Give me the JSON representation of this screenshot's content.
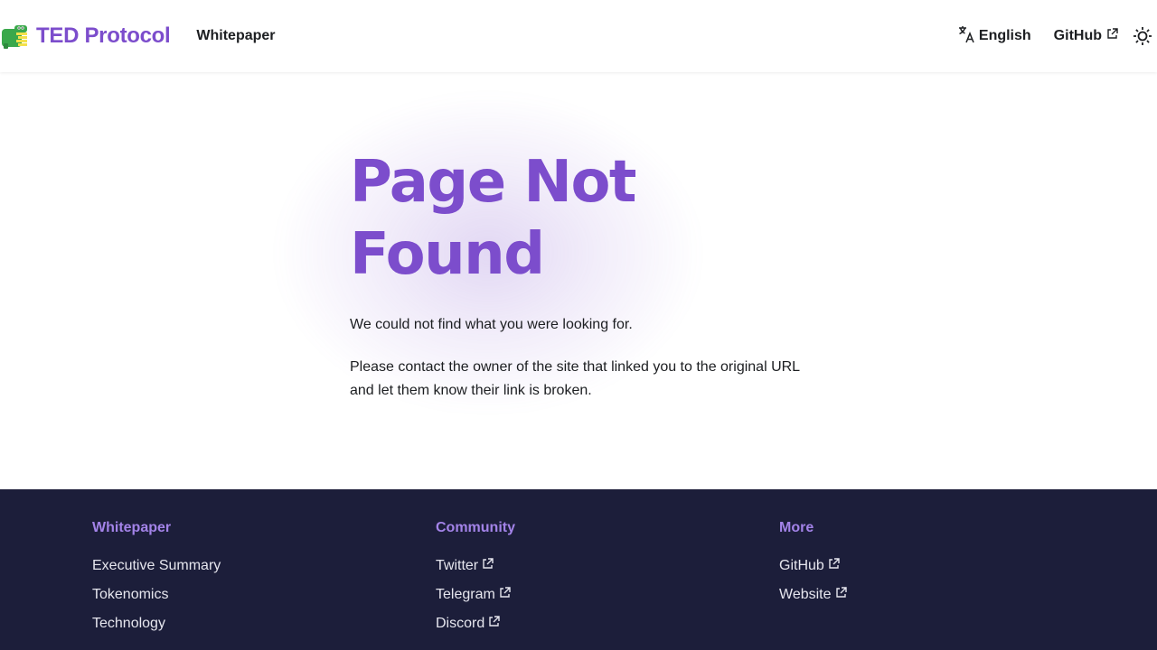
{
  "navbar": {
    "brand_title": "TED Protocol",
    "links": [
      {
        "label": "Whitepaper"
      }
    ],
    "language": "English",
    "github": "GitHub"
  },
  "main": {
    "title": "Page Not Found",
    "paragraph1": "We could not find what you were looking for.",
    "paragraph2": "Please contact the owner of the site that linked you to the original URL and let them know their link is broken."
  },
  "footer": {
    "columns": [
      {
        "title": "Whitepaper",
        "items": [
          {
            "label": "Executive Summary"
          },
          {
            "label": "Tokenomics"
          },
          {
            "label": "Technology"
          }
        ]
      },
      {
        "title": "Community",
        "items": [
          {
            "label": "Twitter"
          },
          {
            "label": "Telegram"
          },
          {
            "label": "Discord"
          }
        ]
      },
      {
        "title": "More",
        "items": [
          {
            "label": "GitHub"
          },
          {
            "label": "Website"
          }
        ]
      }
    ]
  },
  "colors": {
    "accent": "#7c4dcc",
    "footer_bg": "#1c1e3a",
    "footer_heading": "#a383e8"
  },
  "icons": [
    "croc-logo-icon",
    "translate-icon",
    "external-link-icon",
    "sun-icon"
  ]
}
